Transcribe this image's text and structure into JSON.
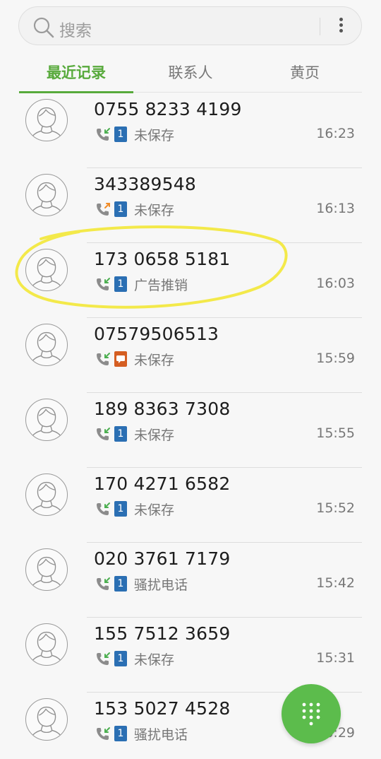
{
  "search": {
    "placeholder": "搜索"
  },
  "tabs": [
    {
      "label": "最近记录",
      "active": true
    },
    {
      "label": "联系人",
      "active": false
    },
    {
      "label": "黄页",
      "active": false
    }
  ],
  "calls": [
    {
      "number": "0755 8233 4199",
      "type": "incoming",
      "sim": "1",
      "status": "未保存",
      "time": "16:23"
    },
    {
      "number": "343389548",
      "type": "outgoing",
      "sim": "1",
      "status": "未保存",
      "time": "16:13"
    },
    {
      "number": "173 0658 5181",
      "type": "incoming",
      "sim": "1",
      "status": "广告推销",
      "time": "16:03"
    },
    {
      "number": "07579506513",
      "type": "incoming",
      "sim": "message",
      "status": "未保存",
      "time": "15:59"
    },
    {
      "number": "189 8363 7308",
      "type": "incoming",
      "sim": "1",
      "status": "未保存",
      "time": "15:55"
    },
    {
      "number": "170 4271 6582",
      "type": "incoming",
      "sim": "1",
      "status": "未保存",
      "time": "15:52"
    },
    {
      "number": "020 3761 7179",
      "type": "incoming",
      "sim": "1",
      "status": "骚扰电话",
      "time": "15:42"
    },
    {
      "number": "155 7512 3659",
      "type": "incoming",
      "sim": "1",
      "status": "未保存",
      "time": "15:31"
    },
    {
      "number": "153 5027 4528",
      "type": "incoming",
      "sim": "1",
      "status": "骚扰电话",
      "time": "16:29"
    }
  ],
  "colors": {
    "accent": "#58aa3c",
    "fab": "#5cbc4c",
    "sim": "#2b6fb3",
    "incoming_arrow": "#4caf50",
    "outgoing_arrow": "#f08c28",
    "annotation": "#f3e94a"
  },
  "icons": {
    "search": "search-icon",
    "more": "more-vert-icon",
    "avatar": "person-avatar-icon",
    "dialpad": "dialpad-icon"
  }
}
